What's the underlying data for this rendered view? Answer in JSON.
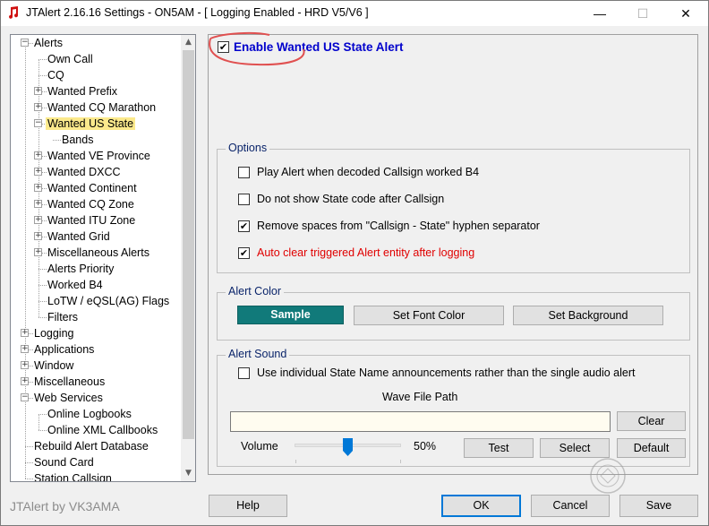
{
  "window": {
    "title": "JTAlert 2.16.16 Settings  -  ON5AM  -  [ Logging Enabled - HRD V5/V6 ]",
    "minimize": "—",
    "maximize": "☐",
    "close": "✕"
  },
  "tree": {
    "items": [
      {
        "label": "Alerts",
        "expander": "⊟"
      },
      {
        "label": "Own Call"
      },
      {
        "label": "CQ"
      },
      {
        "label": "Wanted Prefix",
        "expander": "+"
      },
      {
        "label": "Wanted CQ Marathon",
        "expander": "+"
      },
      {
        "label": "Wanted US State",
        "expander": "−",
        "selected": true
      },
      {
        "label": "Bands"
      },
      {
        "label": "Wanted VE Province",
        "expander": "+"
      },
      {
        "label": "Wanted DXCC",
        "expander": "+"
      },
      {
        "label": "Wanted Continent",
        "expander": "+"
      },
      {
        "label": "Wanted CQ Zone",
        "expander": "+"
      },
      {
        "label": "Wanted ITU Zone",
        "expander": "+"
      },
      {
        "label": "Wanted Grid",
        "expander": "+"
      },
      {
        "label": "Miscellaneous Alerts",
        "expander": "+"
      },
      {
        "label": "Alerts Priority"
      },
      {
        "label": "Worked B4"
      },
      {
        "label": "LoTW / eQSL(AG) Flags"
      },
      {
        "label": "Filters"
      },
      {
        "label": "Logging",
        "expander": "+"
      },
      {
        "label": "Applications",
        "expander": "+"
      },
      {
        "label": "Window",
        "expander": "+"
      },
      {
        "label": "Miscellaneous",
        "expander": "+"
      },
      {
        "label": "Web Services",
        "expander": "−"
      },
      {
        "label": "Online Logbooks"
      },
      {
        "label": "Online XML Callbooks"
      },
      {
        "label": "Rebuild Alert Database"
      },
      {
        "label": "Sound Card"
      },
      {
        "label": "Station Callsign"
      }
    ]
  },
  "enable_alert": {
    "label": "Enable Wanted US State Alert",
    "checked": true
  },
  "options": {
    "legend": "Options",
    "items": [
      {
        "label": "Play Alert when decoded Callsign worked B4",
        "checked": false,
        "color": "#000000"
      },
      {
        "label": "Do not show State code after Callsign",
        "checked": false,
        "color": "#000000"
      },
      {
        "label": "Remove spaces from \"Callsign - State\" hyphen separator",
        "checked": true,
        "color": "#000000"
      },
      {
        "label": "Auto clear triggered Alert entity after logging",
        "checked": true,
        "color": "#e00000"
      }
    ]
  },
  "alert_color": {
    "legend": "Alert Color",
    "sample_label": "Sample",
    "sample_color": "#117a7a",
    "set_font_label": "Set Font Color",
    "set_background_label": "Set Background"
  },
  "alert_sound": {
    "legend": "Alert Sound",
    "use_individual_label": "Use individual State Name announcements rather than the single audio alert",
    "use_individual_checked": false,
    "wave_path_label": "Wave File Path",
    "wave_path_value": "",
    "clear_label": "Clear",
    "volume_label": "Volume",
    "volume_value": "50%",
    "volume_fraction": 0.5,
    "test_label": "Test",
    "select_label": "Select",
    "default_label": "Default"
  },
  "footer": {
    "brand": "JTAlert by VK3AMA",
    "help_label": "Help",
    "ok_label": "OK",
    "cancel_label": "Cancel",
    "save_label": "Save"
  },
  "colors": {
    "accent": "#0078d7",
    "enable_label": "#0000cc",
    "selection": "#fbe98c",
    "annotation": "#e05050"
  }
}
